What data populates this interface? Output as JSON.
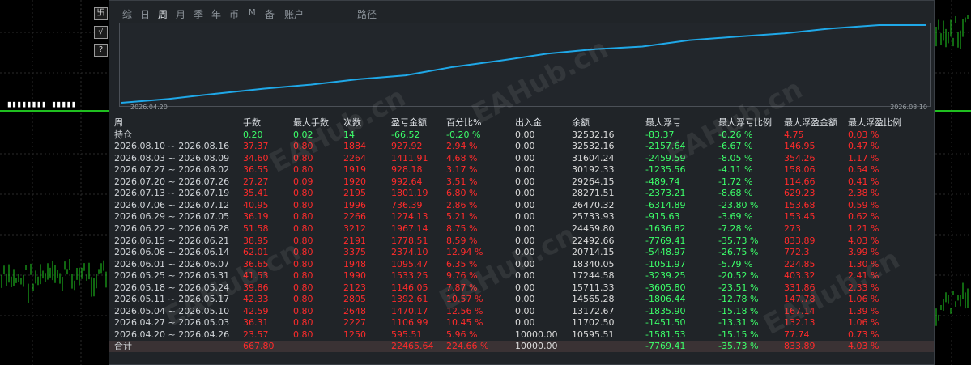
{
  "side_buttons": [
    "卐",
    "√",
    "?"
  ],
  "ea_label": "▮▮▮▮▮▮▮▮ ▮▮▮▮▮",
  "tabs": [
    {
      "label": "综",
      "active": false
    },
    {
      "label": "日",
      "active": false
    },
    {
      "label": "周",
      "active": true
    },
    {
      "label": "月",
      "active": false
    },
    {
      "label": "季",
      "active": false
    },
    {
      "label": "年",
      "active": false
    },
    {
      "label": "币",
      "active": false
    },
    {
      "label": "M",
      "active": false
    },
    {
      "label": "备",
      "active": false
    },
    {
      "label": "账户",
      "active": false
    },
    {
      "label": "路径",
      "active": false
    }
  ],
  "curve": {
    "start_date": "2026.04.20",
    "end_date": "2026.08.10",
    "line_color": "#1fa8e8",
    "values": [
      10595.51,
      11702.5,
      13172.67,
      14565.28,
      15711.33,
      17244.58,
      18340.05,
      20714.15,
      22492.66,
      24459.8,
      25733.93,
      26470.32,
      28271.51,
      29264.15,
      30192.33,
      31604.24,
      32532.16,
      32532.16
    ]
  },
  "watermark": "EAHub.cn",
  "table": {
    "headers": [
      "周",
      "手数",
      "最大手数",
      "次数",
      "盈亏金额",
      "百分比%",
      "出入金",
      "余额",
      "最大浮亏",
      "最大浮亏比例",
      "最大浮盈金额",
      "最大浮盈比例"
    ],
    "position_row": [
      "持仓",
      "0.20",
      "0.02",
      "14",
      "-66.52",
      "-0.20 %",
      "0.00",
      "32532.16",
      "-83.37",
      "-0.26 %",
      "4.75",
      "0.03 %"
    ],
    "rows": [
      [
        "2026.08.10 ~ 2026.08.16",
        "37.37",
        "0.80",
        "1884",
        "927.92",
        "2.94 %",
        "0.00",
        "32532.16",
        "-2157.64",
        "-6.67 %",
        "146.95",
        "0.47 %"
      ],
      [
        "2026.08.03 ~ 2026.08.09",
        "34.60",
        "0.80",
        "2264",
        "1411.91",
        "4.68 %",
        "0.00",
        "31604.24",
        "-2459.59",
        "-8.05 %",
        "354.26",
        "1.17 %"
      ],
      [
        "2026.07.27 ~ 2026.08.02",
        "36.55",
        "0.80",
        "1919",
        "928.18",
        "3.17 %",
        "0.00",
        "30192.33",
        "-1235.56",
        "-4.11 %",
        "158.06",
        "0.54 %"
      ],
      [
        "2026.07.20 ~ 2026.07.26",
        "27.27",
        "0.09",
        "1920",
        "992.64",
        "3.51 %",
        "0.00",
        "29264.15",
        "-489.74",
        "-1.72 %",
        "114.66",
        "0.41 %"
      ],
      [
        "2026.07.13 ~ 2026.07.19",
        "35.41",
        "0.80",
        "2195",
        "1801.19",
        "6.80 %",
        "0.00",
        "28271.51",
        "-2373.21",
        "-8.68 %",
        "629.23",
        "2.38 %"
      ],
      [
        "2026.07.06 ~ 2026.07.12",
        "40.95",
        "0.80",
        "1996",
        "736.39",
        "2.86 %",
        "0.00",
        "26470.32",
        "-6314.89",
        "-23.80 %",
        "153.68",
        "0.59 %"
      ],
      [
        "2026.06.29 ~ 2026.07.05",
        "36.19",
        "0.80",
        "2266",
        "1274.13",
        "5.21 %",
        "0.00",
        "25733.93",
        "-915.63",
        "-3.69 %",
        "153.45",
        "0.62 %"
      ],
      [
        "2026.06.22 ~ 2026.06.28",
        "51.58",
        "0.80",
        "3212",
        "1967.14",
        "8.75 %",
        "0.00",
        "24459.80",
        "-1636.82",
        "-7.28 %",
        "273",
        "1.21 %"
      ],
      [
        "2026.06.15 ~ 2026.06.21",
        "38.95",
        "0.80",
        "2191",
        "1778.51",
        "8.59 %",
        "0.00",
        "22492.66",
        "-7769.41",
        "-35.73 %",
        "833.89",
        "4.03 %"
      ],
      [
        "2026.06.08 ~ 2026.06.14",
        "62.01",
        "0.80",
        "3375",
        "2374.10",
        "12.94 %",
        "0.00",
        "20714.15",
        "-5448.97",
        "-26.75 %",
        "772.3",
        "3.99 %"
      ],
      [
        "2026.06.01 ~ 2026.06.07",
        "36.65",
        "0.80",
        "1948",
        "1095.47",
        "6.35 %",
        "0.00",
        "18340.05",
        "-1051.97",
        "-5.79 %",
        "224.85",
        "1.30 %"
      ],
      [
        "2026.05.25 ~ 2026.05.31",
        "41.53",
        "0.80",
        "1990",
        "1533.25",
        "9.76 %",
        "0.00",
        "17244.58",
        "-3239.25",
        "-20.52 %",
        "403.32",
        "2.41 %"
      ],
      [
        "2026.05.18 ~ 2026.05.24",
        "39.86",
        "0.80",
        "2123",
        "1146.05",
        "7.87 %",
        "0.00",
        "15711.33",
        "-3605.80",
        "-23.51 %",
        "331.86",
        "2.33 %"
      ],
      [
        "2026.05.11 ~ 2026.05.17",
        "42.33",
        "0.80",
        "2805",
        "1392.61",
        "10.57 %",
        "0.00",
        "14565.28",
        "-1806.44",
        "-12.78 %",
        "147.78",
        "1.06 %"
      ],
      [
        "2026.05.04 ~ 2026.05.10",
        "42.59",
        "0.80",
        "2648",
        "1470.17",
        "12.56 %",
        "0.00",
        "13172.67",
        "-1835.90",
        "-15.18 %",
        "167.14",
        "1.39 %"
      ],
      [
        "2026.04.27 ~ 2026.05.03",
        "36.31",
        "0.80",
        "2227",
        "1106.99",
        "10.45 %",
        "0.00",
        "11702.50",
        "-1451.50",
        "-13.31 %",
        "132.13",
        "1.06 %"
      ],
      [
        "2026.04.20 ~ 2026.04.26",
        "23.57",
        "0.80",
        "1250",
        "595.51",
        "5.96 %",
        "10000.00",
        "10595.51",
        "-1581.53",
        "-15.15 %",
        "77.74",
        "0.73 %"
      ]
    ],
    "total_row": [
      "合计",
      "667.80",
      "",
      "",
      "22465.64",
      "224.66 %",
      "10000.00",
      "",
      "-7769.41",
      "-35.73 %",
      "833.89",
      "4.03 %"
    ]
  }
}
